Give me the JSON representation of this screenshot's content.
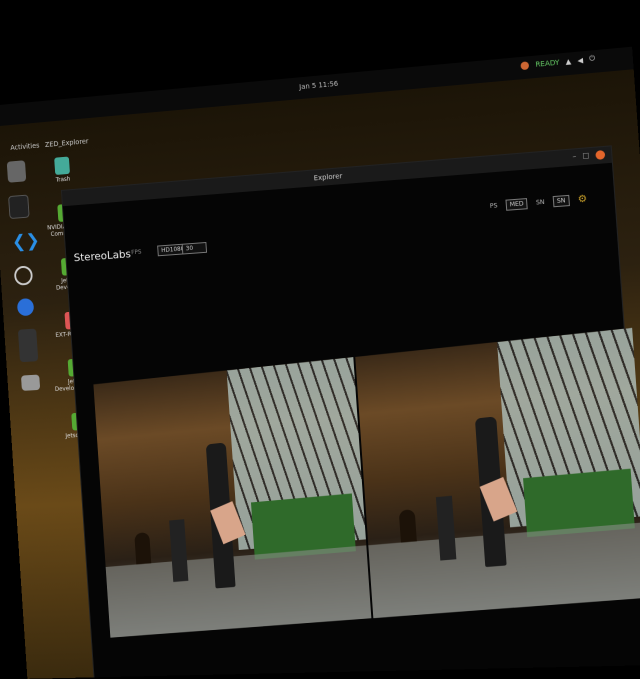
{
  "topbar": {
    "activities": "Activities",
    "clock": "Jan 5 11:56",
    "tray_text": "READY"
  },
  "appbar": {
    "app_name": "ZED_Explorer"
  },
  "desktop_icons": [
    "Trash",
    "NVIDIA Jetson Community",
    "Jetson Developer",
    "EXT-README",
    "Jetson Developer Zone",
    "Jetson Zoo"
  ],
  "window": {
    "title": "Explorer",
    "logo": "StereoLabs",
    "resolution_value": "HD1080",
    "fps_value": "30",
    "fps_label": "FPS",
    "right_label_1": "PS",
    "right_select_1": "MED",
    "right_label_2": "SN",
    "right_select_2": "SN"
  }
}
